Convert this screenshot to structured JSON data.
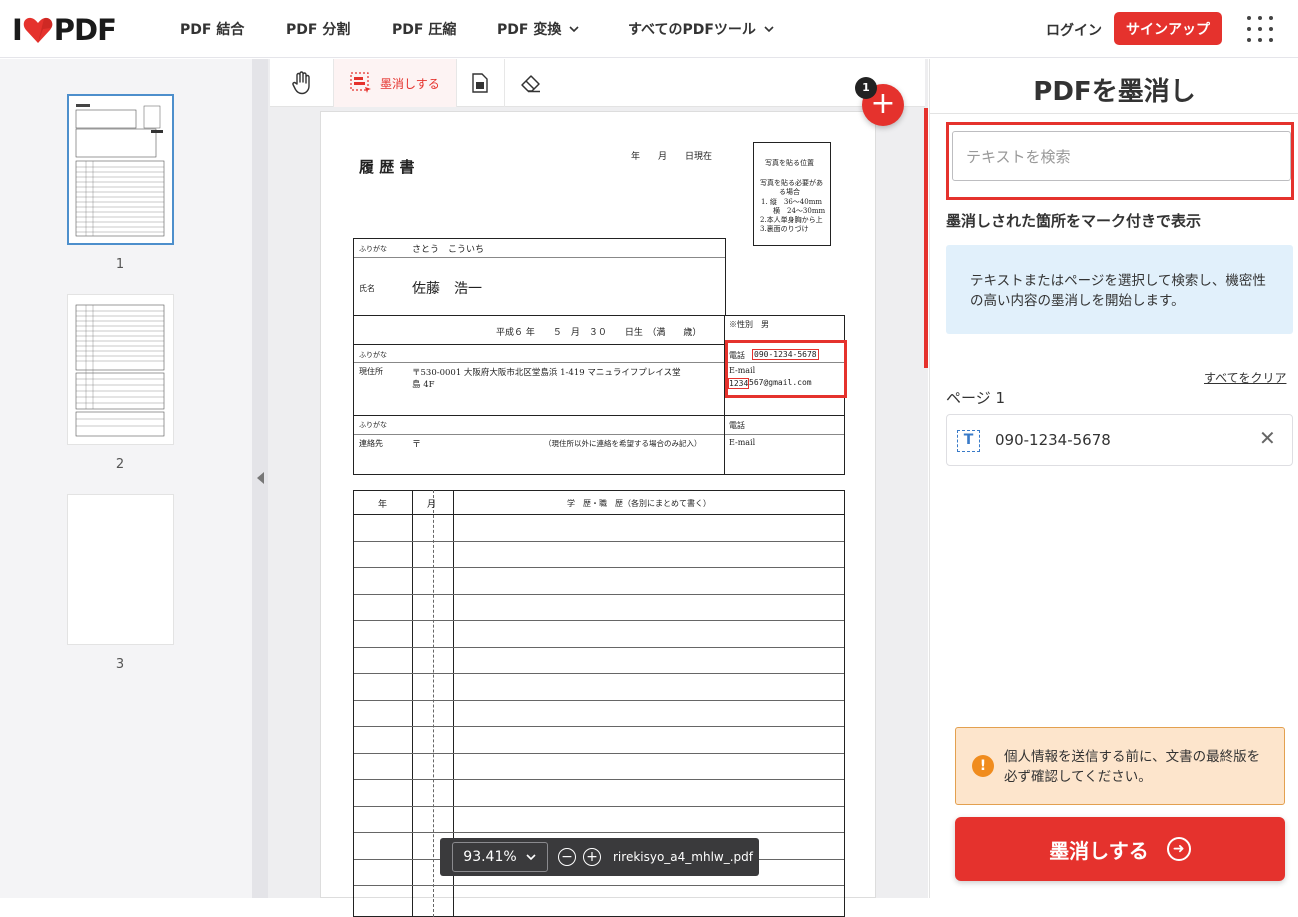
{
  "header": {
    "logo_left": "I",
    "logo_right": "PDF",
    "nav": [
      "PDF 結合",
      "PDF 分割",
      "PDF 圧縮",
      "PDF 変換",
      "すべてのPDFツール"
    ],
    "login": "ログイン",
    "signup": "サインアップ"
  },
  "thumbnails": [
    "1",
    "2",
    "3"
  ],
  "toolbar": {
    "redact_label": "墨消しする"
  },
  "fab_badge": "1",
  "zoom": {
    "value": "93.41%",
    "filename": "rirekisyo_a4_mhlw_.pdf"
  },
  "document": {
    "title": "履 歴 書",
    "date_header": "年　　月　　日現在",
    "furigana_label": "ふりがな",
    "furigana_value": "さとう　こういち",
    "name_label": "氏名",
    "name_value": "佐藤　浩一",
    "birth": "平成６ 年　　５　月　３０　　日生　（満　　歳）",
    "gender": "※性別　男",
    "address_label": "現住所",
    "address_value": "〒530-0001 大阪府大阪市北区堂島浜 1-419 マニュライフプレイス堂",
    "address_value2": "島 4F",
    "phone_label": "電話",
    "phone_value": "090-1234-5678",
    "email_label": "E-mail",
    "email_value_a": "1234",
    "email_value_b": "567@gmail.com",
    "contact_label": "連絡先",
    "contact_zip": "〒",
    "contact_note": "（現住所以外に連絡を希望する場合のみ記入）",
    "phone_label2": "電話",
    "email_label2": "E-mail",
    "photo_title": "写真を貼る位置",
    "photo_line1": "写真を貼る必要があ",
    "photo_line2": "る場合",
    "photo_line3": "1. 縦　36～40mm",
    "photo_line4": "横　24～30mm",
    "photo_line5": "2.本人単身胸から上",
    "photo_line6": "3.裏面のりづけ",
    "history_year": "年",
    "history_month": "月",
    "history_title": "学　歴・職　歴（各別にまとめて書く）"
  },
  "panel": {
    "title": "PDFを墨消し",
    "search_placeholder": "テキストを検索",
    "subtitle": "墨消しされた箇所をマーク付きで表示",
    "info": "テキストまたはページを選択して検索し、機密性の高い内容の墨消しを開始します。",
    "clear_all": "すべてをクリア",
    "page_label": "ページ 1",
    "entries": [
      "090-1234-5678"
    ],
    "warning": "個人情報を送信する前に、文書の最終版を必ず確認してください。",
    "redact_button": "墨消しする"
  },
  "colors": {
    "brand_red": "#e5322d",
    "info_blue": "#e1f0fb",
    "warning_bg": "#fde5cc"
  }
}
